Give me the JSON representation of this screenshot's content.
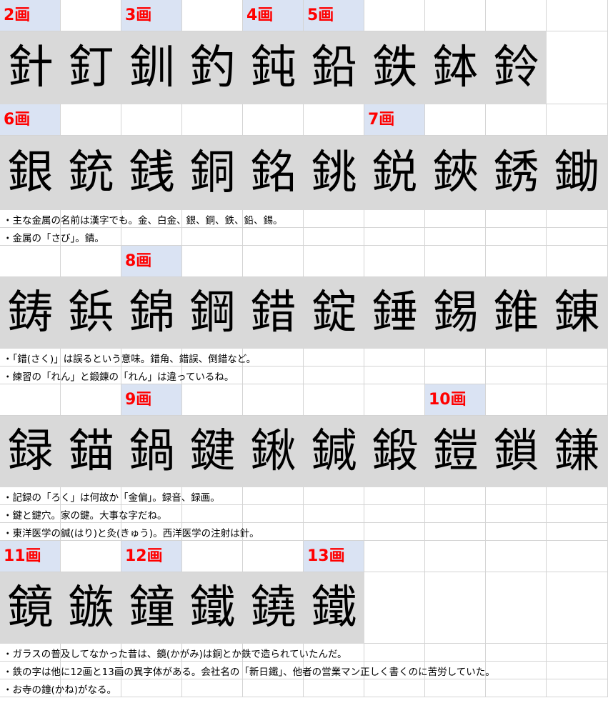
{
  "sections": [
    {
      "labels": [
        {
          "text": "2画",
          "col": 0
        },
        {
          "text": "3画",
          "col": 2
        },
        {
          "text": "4画",
          "col": 4
        },
        {
          "text": "5画",
          "col": 5
        }
      ],
      "kanji": [
        "針",
        "釘",
        "釧",
        "釣",
        "鈍",
        "鉛",
        "鉄",
        "鉢",
        "鈴"
      ],
      "notes": []
    },
    {
      "labels": [
        {
          "text": "6画",
          "col": 0
        },
        {
          "text": "7画",
          "col": 6
        }
      ],
      "kanji": [
        "銀",
        "銃",
        "銭",
        "銅",
        "銘",
        "銚",
        "鋭",
        "鋏",
        "銹",
        "鋤"
      ],
      "notes": [
        "・主な金属の名前は漢字でも。金、白金、銀、銅、鉄、鉛、錫。",
        "・金属の「さび」。錆。"
      ]
    },
    {
      "labels": [
        {
          "text": "8画",
          "col": 2
        }
      ],
      "kanji": [
        "鋳",
        "鋲",
        "錦",
        "鋼",
        "錯",
        "錠",
        "錘",
        "錫",
        "錐",
        "錬"
      ],
      "notes": [
        "・「錯(さく)」は誤るという意味。錯角、錯誤、倒錯など。",
        "・練習の「れん」と鍛錬の「れん」は違っているね。"
      ]
    },
    {
      "labels": [
        {
          "text": "9画",
          "col": 2
        },
        {
          "text": "10画",
          "col": 7
        }
      ],
      "kanji": [
        "録",
        "錨",
        "鍋",
        "鍵",
        "鍬",
        "鍼",
        "鍛",
        "鎧",
        "鎖",
        "鎌"
      ],
      "notes": [
        "・記録の「ろく」は何故か「金偏」。録音、録画。",
        "・鍵と鍵穴。家の鍵。大事な字だね。",
        "・東洋医学の鍼(はり)と灸(きゅう)。西洋医学の注射は針。"
      ]
    },
    {
      "labels": [
        {
          "text": "11画",
          "col": 0
        },
        {
          "text": "12画",
          "col": 2
        },
        {
          "text": "13画",
          "col": 5
        }
      ],
      "kanji": [
        "鏡",
        "鏃",
        "鐘",
        "鐵",
        "鐃",
        "鐵"
      ],
      "notes": [
        "・ガラスの普及してなかった昔は、鏡(かがみ)は銅とか鉄で造られていたんだ。",
        "・鉄の字は他に12画と13画の異字体がある。会社名の「新日鐵」、他者の営業マン正しく書くのに苦労していた。",
        "・お寺の鐘(かね)がなる。"
      ]
    }
  ]
}
